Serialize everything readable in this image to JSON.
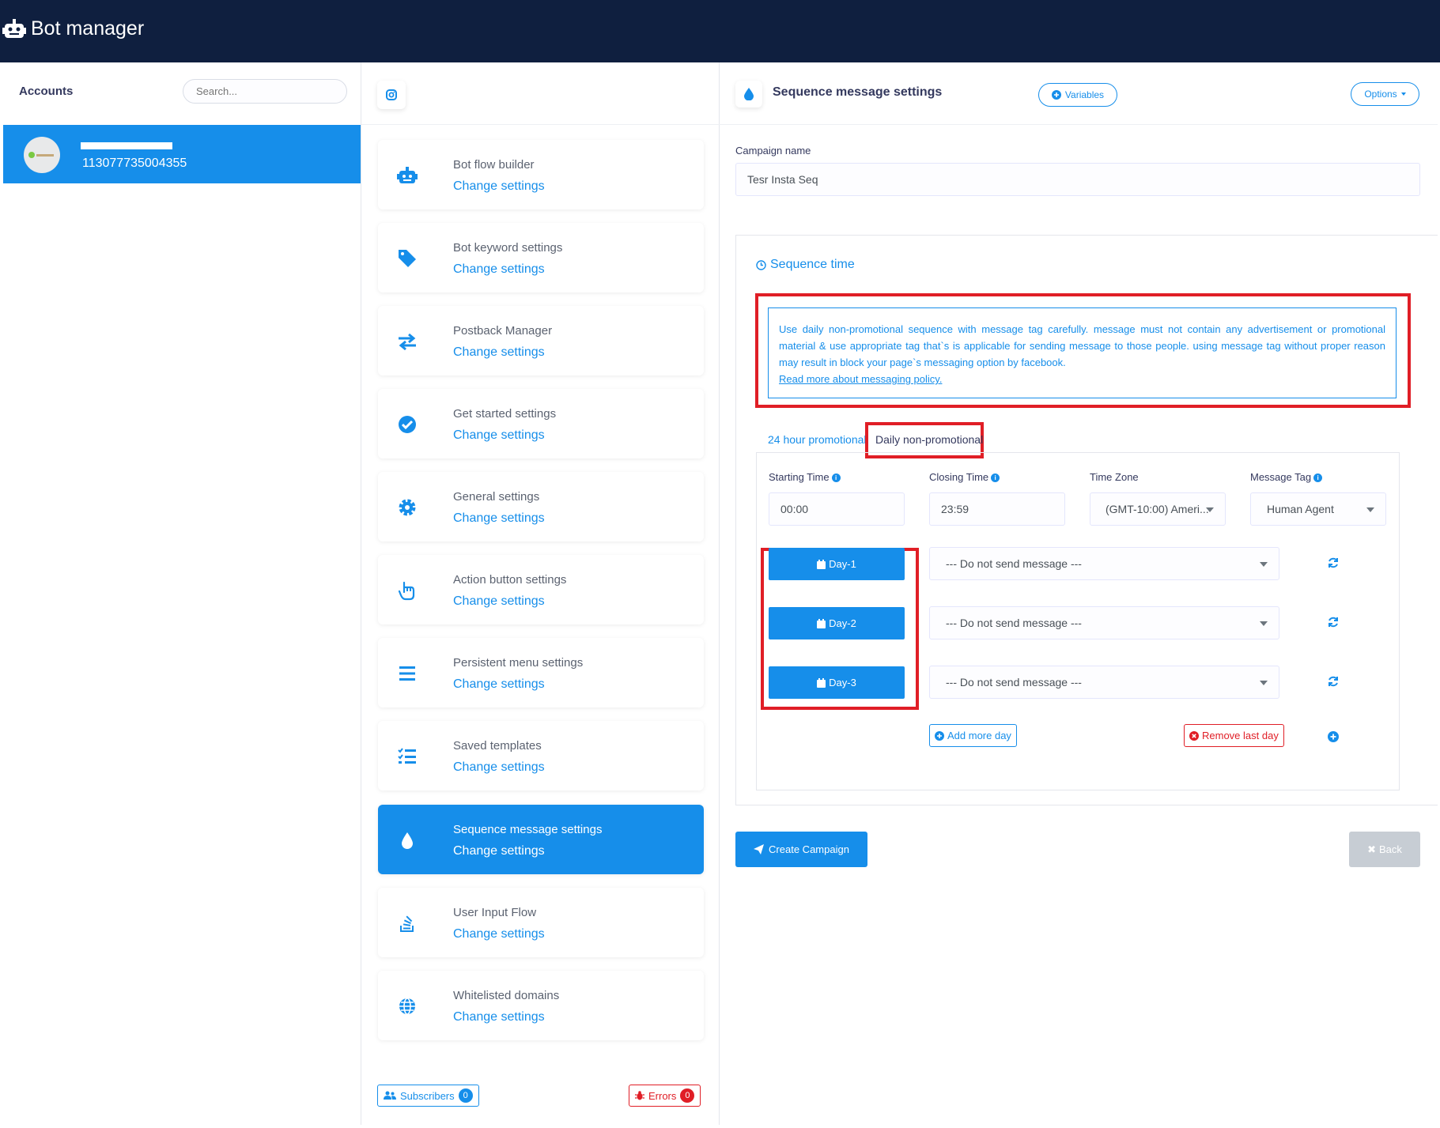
{
  "app": {
    "title": "Bot manager"
  },
  "accounts": {
    "header": "Accounts",
    "search_placeholder": "Search...",
    "items": [
      {
        "id": "113077735004355"
      }
    ]
  },
  "settings_menu": {
    "items": [
      {
        "title": "Bot flow builder",
        "link": "Change settings",
        "icon": "robot-icon"
      },
      {
        "title": "Bot keyword settings",
        "link": "Change settings",
        "icon": "tag-icon"
      },
      {
        "title": "Postback Manager",
        "link": "Change settings",
        "icon": "exchange-arrows-icon"
      },
      {
        "title": "Get started settings",
        "link": "Change settings",
        "icon": "check-circle-icon"
      },
      {
        "title": "General settings",
        "link": "Change settings",
        "icon": "gear-icon"
      },
      {
        "title": "Action button settings",
        "link": "Change settings",
        "icon": "hand-pointer-icon"
      },
      {
        "title": "Persistent menu settings",
        "link": "Change settings",
        "icon": "bars-icon"
      },
      {
        "title": "Saved templates",
        "link": "Change settings",
        "icon": "checklist-icon"
      },
      {
        "title": "Sequence message settings",
        "link": "Change settings",
        "icon": "drop-icon"
      },
      {
        "title": "User Input Flow",
        "link": "Change settings",
        "icon": "stack-overflow-icon"
      },
      {
        "title": "Whitelisted domains",
        "link": "Change settings",
        "icon": "globe-icon"
      }
    ],
    "active_index": 8,
    "footer": {
      "subscribers_label": "Subscribers",
      "subscribers_count": "0",
      "errors_label": "Errors",
      "errors_count": "0"
    }
  },
  "panel": {
    "title": "Sequence message settings",
    "variables_label": "Variables",
    "options_label": "Options",
    "campaign_name_label": "Campaign name",
    "campaign_name_value": "Tesr Insta Seq",
    "sequence_time_label": "Sequence time",
    "notice_text": "Use daily non-promotional sequence with message tag carefully. message must not contain any advertisement or promotional material & use appropriate tag that`s is applicable for sending message to those people. using message tag without proper reason may result in block your page`s messaging option by facebook.",
    "notice_link": "Read more about messaging policy.",
    "tabs": [
      "24 hour promotional",
      "Daily non-promotional"
    ],
    "active_tab": 1,
    "starting_time_label": "Starting Time",
    "starting_time_value": "00:00",
    "closing_time_label": "Closing Time",
    "closing_time_value": "23:59",
    "time_zone_label": "Time Zone",
    "time_zone_value": "(GMT-10:00) Ameri...",
    "message_tag_label": "Message Tag",
    "message_tag_value": "Human Agent",
    "days": [
      {
        "label": "Day-1",
        "message": "--- Do not send message ---"
      },
      {
        "label": "Day-2",
        "message": "--- Do not send message ---"
      },
      {
        "label": "Day-3",
        "message": "--- Do not send message ---"
      }
    ],
    "add_day_label": "Add more day",
    "remove_day_label": "Remove last day",
    "create_label": "Create Campaign",
    "back_label": "Back"
  },
  "colors": {
    "primary": "#168eea",
    "header_bg": "#0f1f3f",
    "danger": "#e01e26",
    "highlight": "#e01e26"
  }
}
